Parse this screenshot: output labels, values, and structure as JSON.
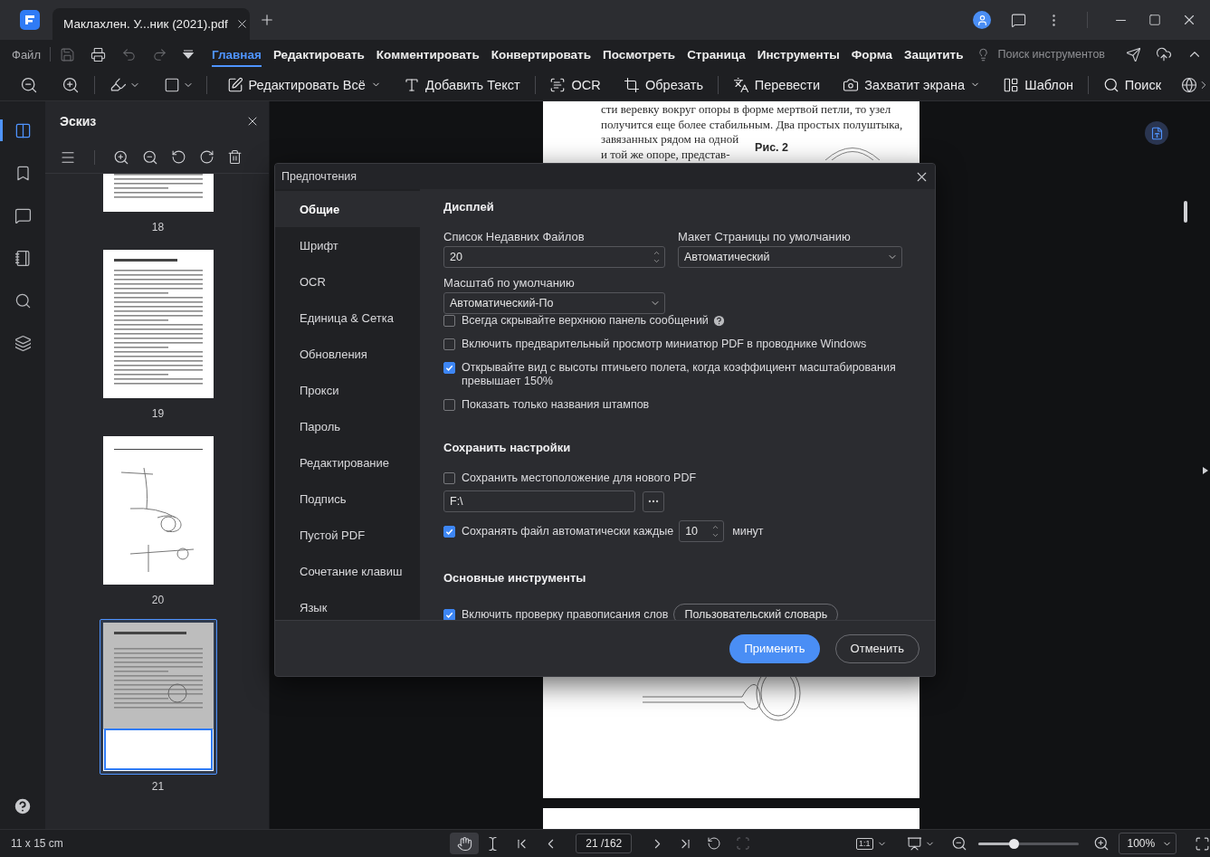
{
  "window": {
    "tab_title": "Маклахлен. У...ник (2021).pdf"
  },
  "menu": {
    "file": "Файл",
    "tabs": [
      {
        "label": "Главная",
        "selected": true
      },
      {
        "label": "Редактировать",
        "selected": false
      },
      {
        "label": "Комментировать",
        "selected": false
      },
      {
        "label": "Конвертировать",
        "selected": false
      },
      {
        "label": "Посмотреть",
        "selected": false
      },
      {
        "label": "Страница",
        "selected": false
      },
      {
        "label": "Инструменты",
        "selected": false
      },
      {
        "label": "Форма",
        "selected": false
      },
      {
        "label": "Защитить",
        "selected": false
      }
    ],
    "tool_search": {
      "placeholder": "Поиск инструментов"
    }
  },
  "toolbar": [
    {
      "label": "Редактировать Всё",
      "dropdown": true
    },
    {
      "label": "Добавить Текст",
      "dropdown": false
    },
    {
      "label": "OCR",
      "dropdown": false
    },
    {
      "label": "Обрезать",
      "dropdown": false
    },
    {
      "label": "Перевести",
      "dropdown": false
    },
    {
      "label": "Захватит экрана",
      "dropdown": true
    },
    {
      "label": "Шаблон",
      "dropdown": false
    },
    {
      "label": "Поиск",
      "dropdown": false
    }
  ],
  "rail": [
    {
      "selected": true
    },
    {
      "selected": false
    },
    {
      "selected": false
    },
    {
      "selected": false
    },
    {
      "selected": false
    },
    {
      "selected": false
    }
  ],
  "thumbnails": {
    "title": "Эскиз",
    "pages": [
      {
        "label": "18",
        "kind": "text",
        "selected": false
      },
      {
        "label": "19",
        "kind": "text",
        "selected": false
      },
      {
        "label": "20",
        "kind": "figure",
        "selected": false
      },
      {
        "label": "21",
        "kind": "mixed",
        "selected": true
      }
    ]
  },
  "document": {
    "lines": [
      "сти веревку вокруг опоры в форме мертвой петли, то узел",
      "получится еще более стабильным. Два простых полуштыка,"
    ],
    "side_lines": [
      "завязанных рядом на одной",
      "и той же опоре, представ-"
    ],
    "caption": "Рис. 2"
  },
  "dialog": {
    "title": "Предпочтения",
    "nav": [
      {
        "label": "Общие",
        "selected": true
      },
      {
        "label": "Шрифт",
        "selected": false
      },
      {
        "label": "OCR",
        "selected": false
      },
      {
        "label": "Единица & Сетка",
        "selected": false
      },
      {
        "label": "Обновления",
        "selected": false
      },
      {
        "label": "Прокси",
        "selected": false
      },
      {
        "label": "Пароль",
        "selected": false
      },
      {
        "label": "Редактирование",
        "selected": false
      },
      {
        "label": "Подпись",
        "selected": false
      },
      {
        "label": "Пустой PDF",
        "selected": false
      },
      {
        "label": "Сочетание клавиш",
        "selected": false
      },
      {
        "label": "Язык",
        "selected": false
      }
    ],
    "display": {
      "heading": "Дисплей",
      "recent_files": {
        "label": "Список Недавних Файлов",
        "value": "20"
      },
      "page_layout": {
        "label": "Макет Страницы по умолчанию",
        "value": "Автоматический"
      },
      "default_zoom": {
        "label": "Масштаб по умолчанию",
        "value": "Автоматический-По"
      },
      "options": [
        {
          "label": "Всегда скрывайте верхнюю панель сообщений",
          "checked": false,
          "help": true
        },
        {
          "label": "Включить предварительный просмотр миниатюр PDF в проводнике Windows",
          "checked": false,
          "help": false
        },
        {
          "label": "Открывайте вид с высоты птичьего полета, когда коэффициент масштабирования превышает 150%",
          "checked": true,
          "help": false
        },
        {
          "label": "Показать только названия штампов",
          "checked": false,
          "help": false
        }
      ]
    },
    "save": {
      "heading": "Сохранить настройки",
      "location": {
        "label": "Сохранить местоположение для нового PDF",
        "checked": false
      },
      "path": {
        "value": "F:\\"
      },
      "autosave": {
        "label": "Сохранять файл автоматически каждые",
        "checked": true,
        "value": "10",
        "unit": "минут"
      }
    },
    "tools": {
      "heading": "Основные инструменты",
      "spellcheck": {
        "label": "Включить проверку правописания слов",
        "checked": true
      },
      "dictionary_button": "Пользовательский словарь"
    },
    "buttons": {
      "apply": "Применить",
      "cancel": "Отменить"
    }
  },
  "status_bar": {
    "page_size": "11 x 15 cm",
    "page_field": "21 /162",
    "actual_size": "1:1",
    "zoom": {
      "level": 0.36
    },
    "zoom_value": "100%"
  }
}
